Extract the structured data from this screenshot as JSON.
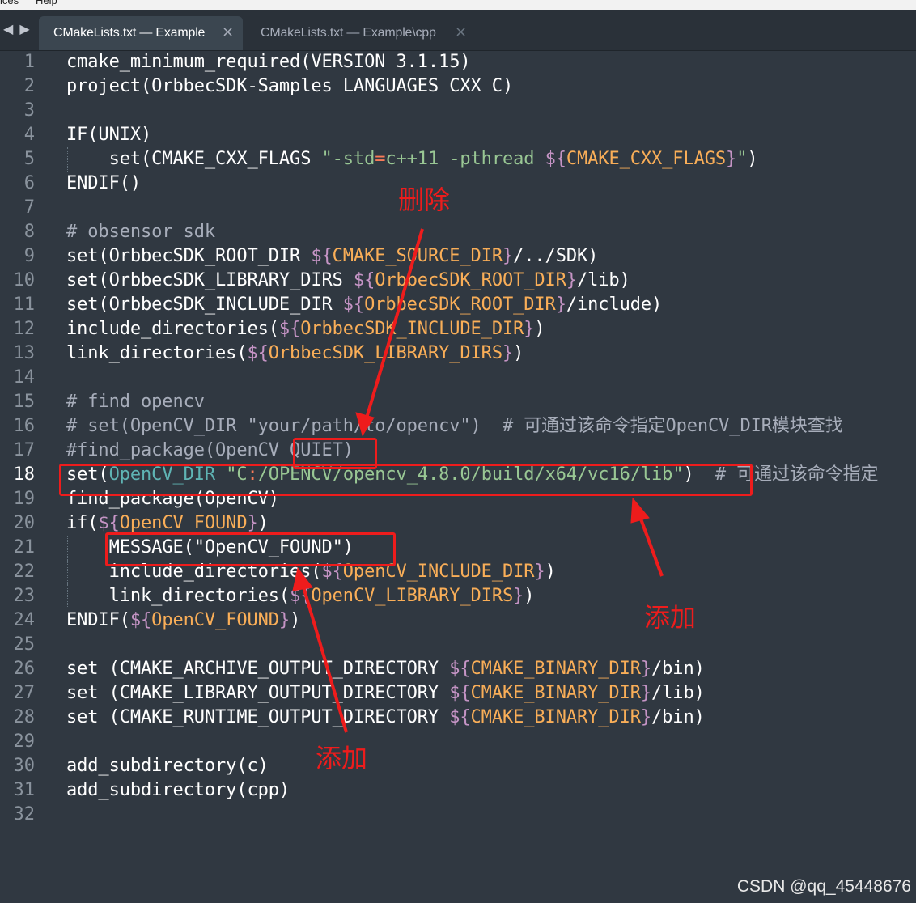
{
  "menubar": {
    "left_fragment": "ices",
    "right_fragment": "Help"
  },
  "tabs": [
    {
      "label": "CMakeLists.txt — Example",
      "close": "×",
      "active": true
    },
    {
      "label": "CMakeLists.txt — Example\\cpp",
      "close": "×",
      "active": false
    }
  ],
  "nav": {
    "back": "◀",
    "forward": "▶"
  },
  "colors": {
    "background": "#303841",
    "line_number": "#8a939d",
    "string": "#99c794",
    "variable": "#f9ae58",
    "dollar": "#c594c5",
    "keyword": "#5fb4b4",
    "annotation": "#ee1c1c"
  },
  "editor": {
    "current_line": 18,
    "lines": [
      {
        "n": "1",
        "tokens": [
          [
            "fn",
            "cmake_minimum_required(VERSION 3.1.15)"
          ]
        ]
      },
      {
        "n": "2",
        "tokens": [
          [
            "fn",
            "project(OrbbecSDK-Samples LANGUAGES CXX C)"
          ]
        ]
      },
      {
        "n": "3",
        "tokens": []
      },
      {
        "n": "4",
        "tokens": [
          [
            "fn",
            "IF(UNIX)"
          ]
        ]
      },
      {
        "n": "5",
        "indent": true,
        "tokens": [
          [
            "fn",
            "    set(CMAKE_CXX_FLAGS "
          ],
          [
            "str",
            "\"-std"
          ],
          [
            "op",
            "="
          ],
          [
            "str",
            "c++11 -pthread "
          ],
          [
            "dollar",
            "${"
          ],
          [
            "var",
            "CMAKE_CXX_FLAGS"
          ],
          [
            "dollar",
            "}"
          ],
          [
            "str",
            "\""
          ],
          [
            "fn",
            ")"
          ]
        ]
      },
      {
        "n": "6",
        "tokens": [
          [
            "fn",
            "ENDIF()"
          ]
        ]
      },
      {
        "n": "7",
        "tokens": []
      },
      {
        "n": "8",
        "tokens": [
          [
            "comment",
            "# obsensor sdk"
          ]
        ]
      },
      {
        "n": "9",
        "tokens": [
          [
            "fn",
            "set(OrbbecSDK_ROOT_DIR "
          ],
          [
            "dollar",
            "${"
          ],
          [
            "var",
            "CMAKE_SOURCE_DIR"
          ],
          [
            "dollar",
            "}"
          ],
          [
            "fn",
            "/../SDK)"
          ]
        ]
      },
      {
        "n": "10",
        "tokens": [
          [
            "fn",
            "set(OrbbecSDK_LIBRARY_DIRS "
          ],
          [
            "dollar",
            "${"
          ],
          [
            "var",
            "OrbbecSDK_ROOT_DIR"
          ],
          [
            "dollar",
            "}"
          ],
          [
            "fn",
            "/lib)"
          ]
        ]
      },
      {
        "n": "11",
        "tokens": [
          [
            "fn",
            "set(OrbbecSDK_INCLUDE_DIR "
          ],
          [
            "dollar",
            "${"
          ],
          [
            "var",
            "OrbbecSDK_ROOT_DIR"
          ],
          [
            "dollar",
            "}"
          ],
          [
            "fn",
            "/include)"
          ]
        ]
      },
      {
        "n": "12",
        "tokens": [
          [
            "fn",
            "include_directories("
          ],
          [
            "dollar",
            "${"
          ],
          [
            "var",
            "OrbbecSDK_INCLUDE_DIR"
          ],
          [
            "dollar",
            "}"
          ],
          [
            "fn",
            ")"
          ]
        ]
      },
      {
        "n": "13",
        "tokens": [
          [
            "fn",
            "link_directories("
          ],
          [
            "dollar",
            "${"
          ],
          [
            "var",
            "OrbbecSDK_LIBRARY_DIRS"
          ],
          [
            "dollar",
            "}"
          ],
          [
            "fn",
            ")"
          ]
        ]
      },
      {
        "n": "14",
        "tokens": []
      },
      {
        "n": "15",
        "tokens": [
          [
            "comment",
            "# find opencv"
          ]
        ]
      },
      {
        "n": "16",
        "tokens": [
          [
            "comment",
            "# set(OpenCV_DIR \"your/path/to/opencv\")  # 可通过该命令指定OpenCV_DIR模块查找"
          ]
        ]
      },
      {
        "n": "17",
        "tokens": [
          [
            "comment",
            "#find_package(OpenCV QUIET)"
          ]
        ]
      },
      {
        "n": "18",
        "tokens": [
          [
            "fn",
            "set("
          ],
          [
            "kw",
            "OpenCV_DIR "
          ],
          [
            "str",
            "\"C"
          ],
          [
            "op",
            ":"
          ],
          [
            "str",
            "/OPENCV/opencv_4.8.0/build/x64/vc16/lib\""
          ],
          [
            "fn",
            ")"
          ],
          [
            "comment",
            "  # 可通过该命令指定"
          ]
        ]
      },
      {
        "n": "19",
        "tokens": [
          [
            "fn",
            "find_package(OpenCV)"
          ]
        ]
      },
      {
        "n": "20",
        "tokens": [
          [
            "fn",
            "if("
          ],
          [
            "dollar",
            "${"
          ],
          [
            "var",
            "OpenCV_FOUND"
          ],
          [
            "dollar",
            "}"
          ],
          [
            "fn",
            ")"
          ]
        ]
      },
      {
        "n": "21",
        "indent": true,
        "tokens": [
          [
            "fn",
            "    MESSAGE("
          ],
          [
            "plain",
            "\"OpenCV_FOUND\""
          ],
          [
            "fn",
            ")"
          ]
        ]
      },
      {
        "n": "22",
        "indent": true,
        "tokens": [
          [
            "fn",
            "    include_directories("
          ],
          [
            "dollar",
            "${"
          ],
          [
            "var",
            "OpenCV_INCLUDE_DIR"
          ],
          [
            "dollar",
            "}"
          ],
          [
            "fn",
            ")"
          ]
        ]
      },
      {
        "n": "23",
        "indent": true,
        "tokens": [
          [
            "fn",
            "    link_directories("
          ],
          [
            "dollar",
            "${"
          ],
          [
            "var",
            "OpenCV_LIBRARY_DIRS"
          ],
          [
            "dollar",
            "}"
          ],
          [
            "fn",
            ")"
          ]
        ]
      },
      {
        "n": "24",
        "tokens": [
          [
            "fn",
            "ENDIF("
          ],
          [
            "dollar",
            "${"
          ],
          [
            "var",
            "OpenCV_FOUND"
          ],
          [
            "dollar",
            "}"
          ],
          [
            "fn",
            ")"
          ]
        ]
      },
      {
        "n": "25",
        "tokens": []
      },
      {
        "n": "26",
        "tokens": [
          [
            "fn",
            "set (CMAKE_ARCHIVE_OUTPUT_DIRECTORY "
          ],
          [
            "dollar",
            "${"
          ],
          [
            "var",
            "CMAKE_BINARY_DIR"
          ],
          [
            "dollar",
            "}"
          ],
          [
            "fn",
            "/bin)"
          ]
        ]
      },
      {
        "n": "27",
        "tokens": [
          [
            "fn",
            "set (CMAKE_LIBRARY_OUTPUT_DIRECTORY "
          ],
          [
            "dollar",
            "${"
          ],
          [
            "var",
            "CMAKE_BINARY_DIR"
          ],
          [
            "dollar",
            "}"
          ],
          [
            "fn",
            "/lib)"
          ]
        ]
      },
      {
        "n": "28",
        "tokens": [
          [
            "fn",
            "set (CMAKE_RUNTIME_OUTPUT_DIRECTORY "
          ],
          [
            "dollar",
            "${"
          ],
          [
            "var",
            "CMAKE_BINARY_DIR"
          ],
          [
            "dollar",
            "}"
          ],
          [
            "fn",
            "/bin)"
          ]
        ]
      },
      {
        "n": "29",
        "tokens": []
      },
      {
        "n": "30",
        "tokens": [
          [
            "fn",
            "add_subdirectory(c)"
          ]
        ]
      },
      {
        "n": "31",
        "tokens": [
          [
            "fn",
            "add_subdirectory(cpp)"
          ]
        ]
      },
      {
        "n": "32",
        "tokens": []
      }
    ]
  },
  "annotations": {
    "delete_label": "删除",
    "add_label_1": "添加",
    "add_label_2": "添加"
  },
  "watermark": "CSDN @qq_45448676"
}
